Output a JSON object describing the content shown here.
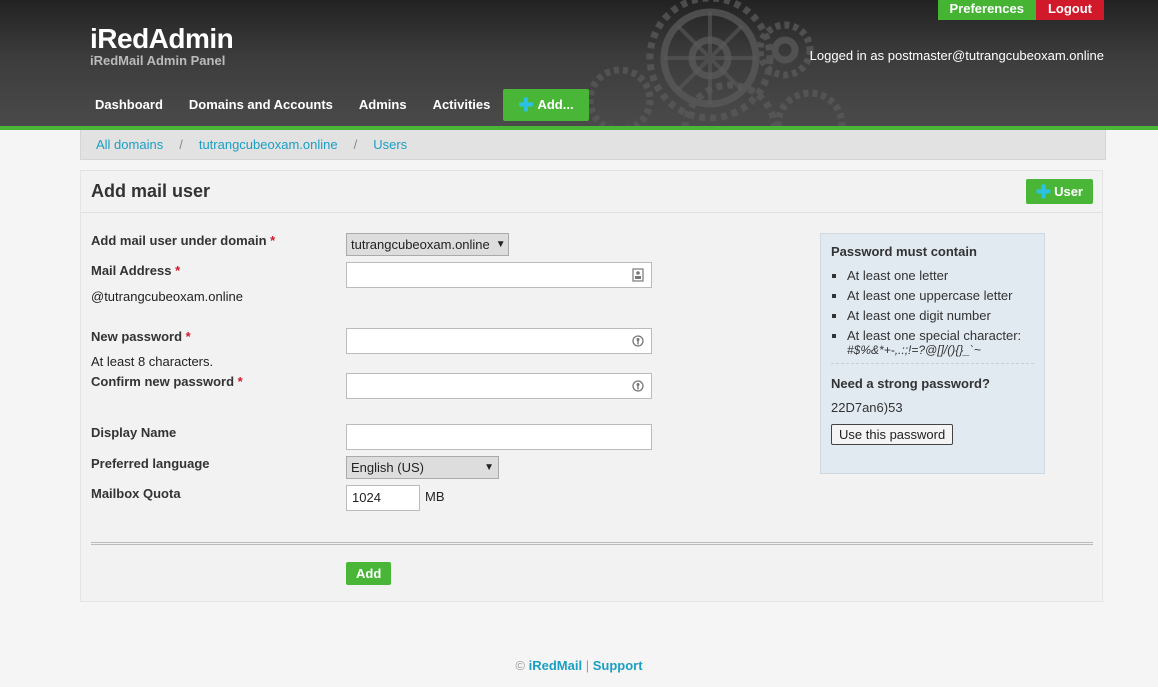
{
  "header": {
    "title": "iRedAdmin",
    "subtitle": "iRedMail Admin Panel",
    "preferences_label": "Preferences",
    "logout_label": "Logout",
    "logged_in_text": "Logged in as postmaster@tutrangcubeoxam.online"
  },
  "nav": {
    "items": [
      {
        "label": "Dashboard"
      },
      {
        "label": "Domains and Accounts"
      },
      {
        "label": "Admins"
      },
      {
        "label": "Activities"
      }
    ],
    "add_label": "Add..."
  },
  "breadcrumb": {
    "items": [
      "All domains",
      "tutrangcubeoxam.online",
      "Users"
    ],
    "separator": "/"
  },
  "form": {
    "title": "Add mail user",
    "user_button_label": "User",
    "domain_label": "Add mail user under domain",
    "domain_value": "tutrangcubeoxam.online",
    "mail_label": "Mail Address",
    "mail_suffix": "@tutrangcubeoxam.online",
    "mail_value": "",
    "password_label": "New password",
    "password_hint": "At least 8 characters.",
    "confirm_label": "Confirm new password",
    "display_name_label": "Display Name",
    "language_label": "Preferred language",
    "language_value": "English (US)",
    "quota_label": "Mailbox Quota",
    "quota_value": "1024",
    "quota_unit": "MB",
    "add_button_label": "Add",
    "required_mark": "*"
  },
  "password_box": {
    "heading": "Password must contain",
    "rules": [
      "At least one letter",
      "At least one uppercase letter",
      "At least one digit number",
      "At least one special character:"
    ],
    "special_chars": "#$%&*+-,.:;!=?@[]/(){}_`~",
    "strong_heading": "Need a strong password?",
    "strong_password": "22D7an6)53",
    "use_button_label": "Use this password"
  },
  "footer": {
    "copyright": "©",
    "iredmail_link": "iRedMail",
    "separator": "|",
    "support_link": "Support"
  },
  "colors": {
    "accent_green": "#49b637",
    "logout_red": "#d0192a",
    "link_blue": "#1a9fc3"
  }
}
